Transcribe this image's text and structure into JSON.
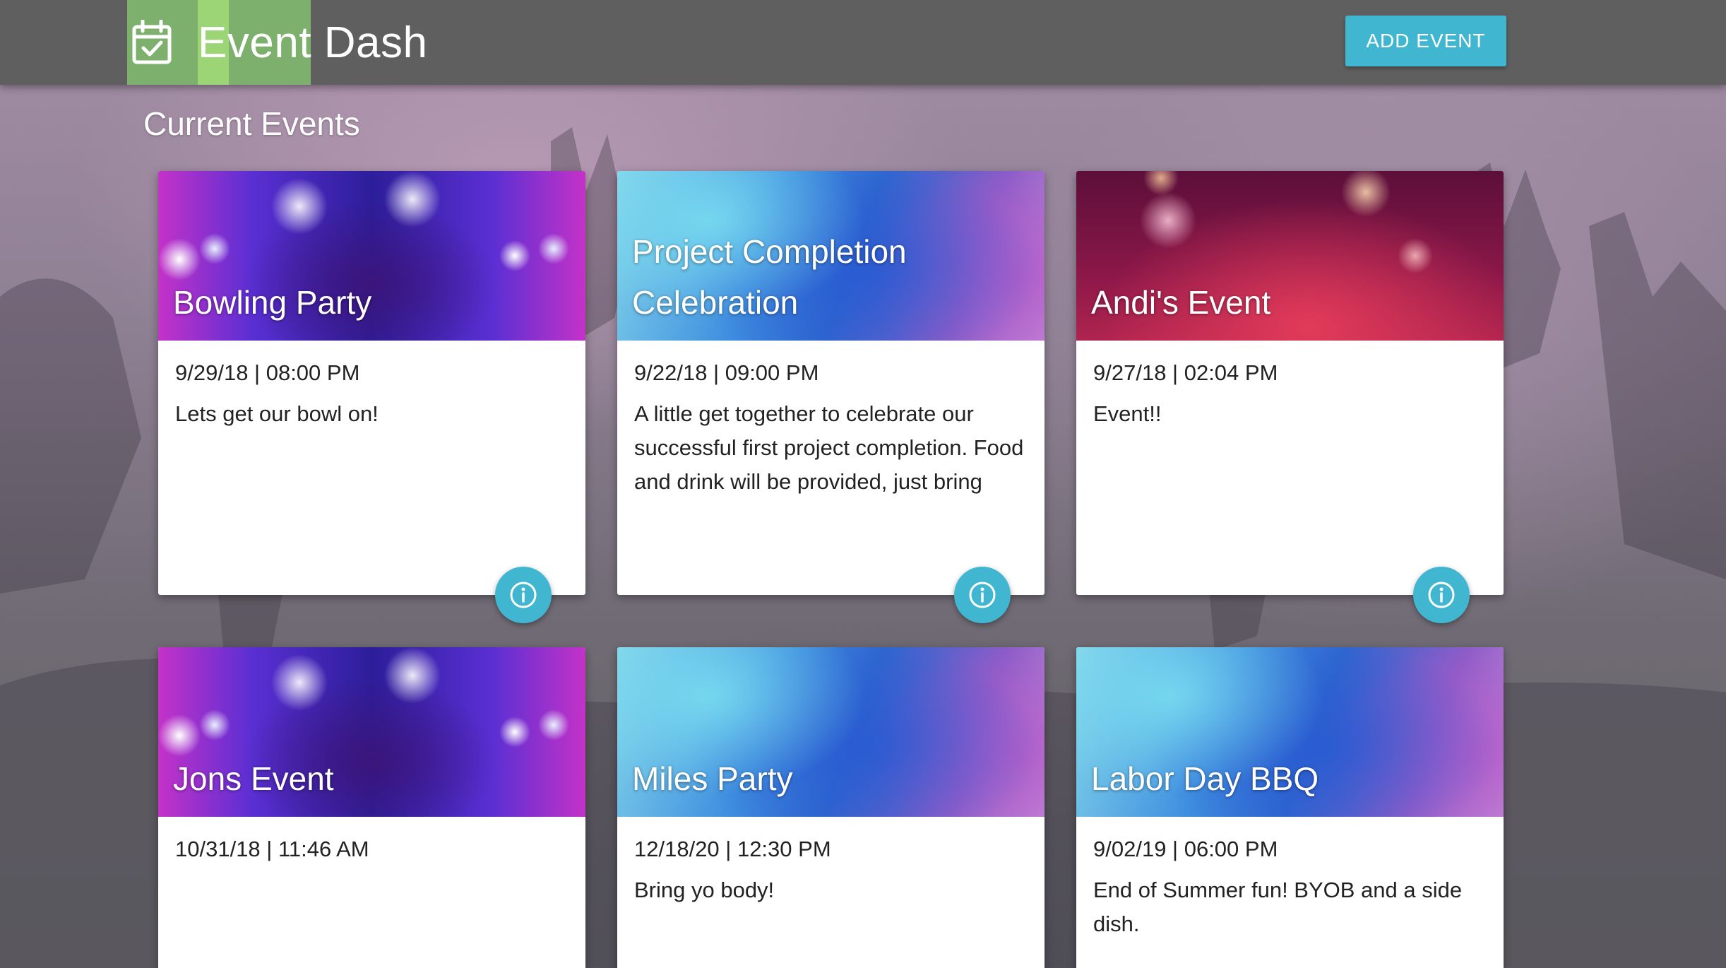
{
  "app": {
    "brand_title": "Event Dash",
    "brand_icon": "calendar-check-icon",
    "add_event_label": "ADD EVENT"
  },
  "section": {
    "title": "Current Events"
  },
  "colors": {
    "navbar": "#5f5f5f",
    "accent": "#41b6d0",
    "brand_highlight": "#82be6e"
  },
  "events": [
    {
      "title": "Bowling Party",
      "datetime": "9/29/18 | 08:00 PM",
      "description": "Lets get our bowl on!",
      "image": "stage-lights"
    },
    {
      "title": "Project Completion Celebration",
      "datetime": "9/22/18 | 09:00 PM",
      "description": "A little get together to celebrate our successful first project completion. Food and drink will be provided, just bring yourselves!",
      "image": "watercolor"
    },
    {
      "title": "Andi's Event",
      "datetime": "9/27/18 | 02:04 PM",
      "description": "Event!!",
      "image": "fireworks"
    },
    {
      "title": "Jons Event",
      "datetime": "10/31/18 | 11:46 AM",
      "description": "",
      "image": "stage-lights"
    },
    {
      "title": "Miles Party",
      "datetime": "12/18/20 | 12:30 PM",
      "description": "Bring yo body!",
      "image": "watercolor"
    },
    {
      "title": "Labor Day BBQ",
      "datetime": "9/02/19 | 06:00 PM",
      "description": "End of Summer fun! BYOB and a side dish.",
      "image": "watercolor"
    }
  ],
  "info_icon": "info-icon"
}
